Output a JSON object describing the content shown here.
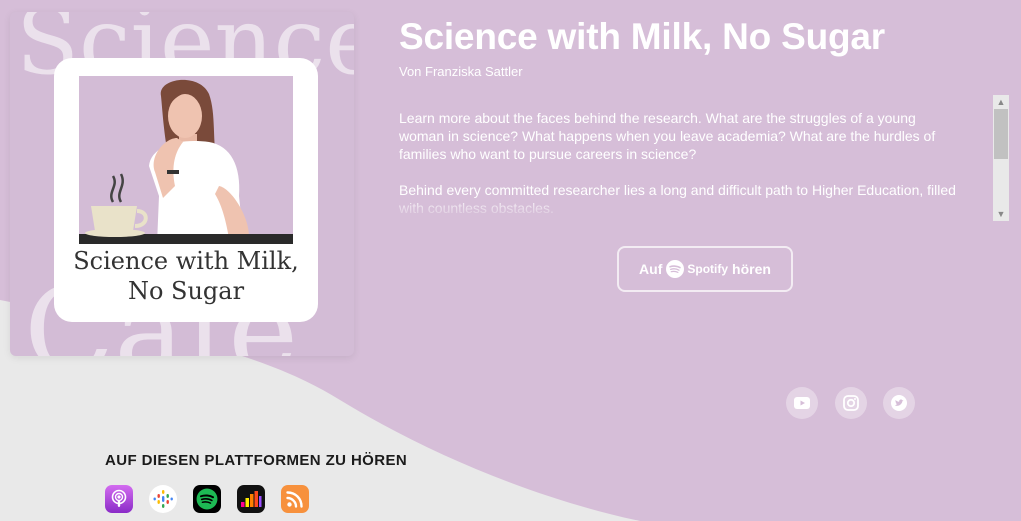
{
  "cover": {
    "bg_word_top": "Science",
    "bg_word_bottom": "Cafe",
    "title_line1": "Science with Milk,",
    "title_line2": "No Sugar"
  },
  "header": {
    "title": "Science with Milk, No Sugar",
    "author": "Von Franziska Sattler"
  },
  "description": {
    "paragraphs": [
      "Learn more about the faces behind the research. What are the struggles of a young woman in science? What happens when you leave academia? What are the hurdles of families who want to pursue careers in science?",
      "Behind every committed researcher lies a long and difficult path to Higher Education, filled with countless obstacles."
    ]
  },
  "listen_button": {
    "prefix": "Auf",
    "brand": "Spotify",
    "suffix": "hören"
  },
  "social_icons": [
    "youtube-icon",
    "instagram-icon",
    "twitter-icon"
  ],
  "platforms": {
    "heading": "AUF DIESEN PLATTFORMEN ZU HÖREN",
    "items": [
      "apple-podcasts-icon",
      "google-podcasts-icon",
      "spotify-icon",
      "deezer-icon",
      "rss-icon"
    ]
  },
  "colors": {
    "background": "#d6bed8",
    "wave": "#e9e9e9",
    "text": "#ffffff",
    "spotify": "#1db954"
  }
}
